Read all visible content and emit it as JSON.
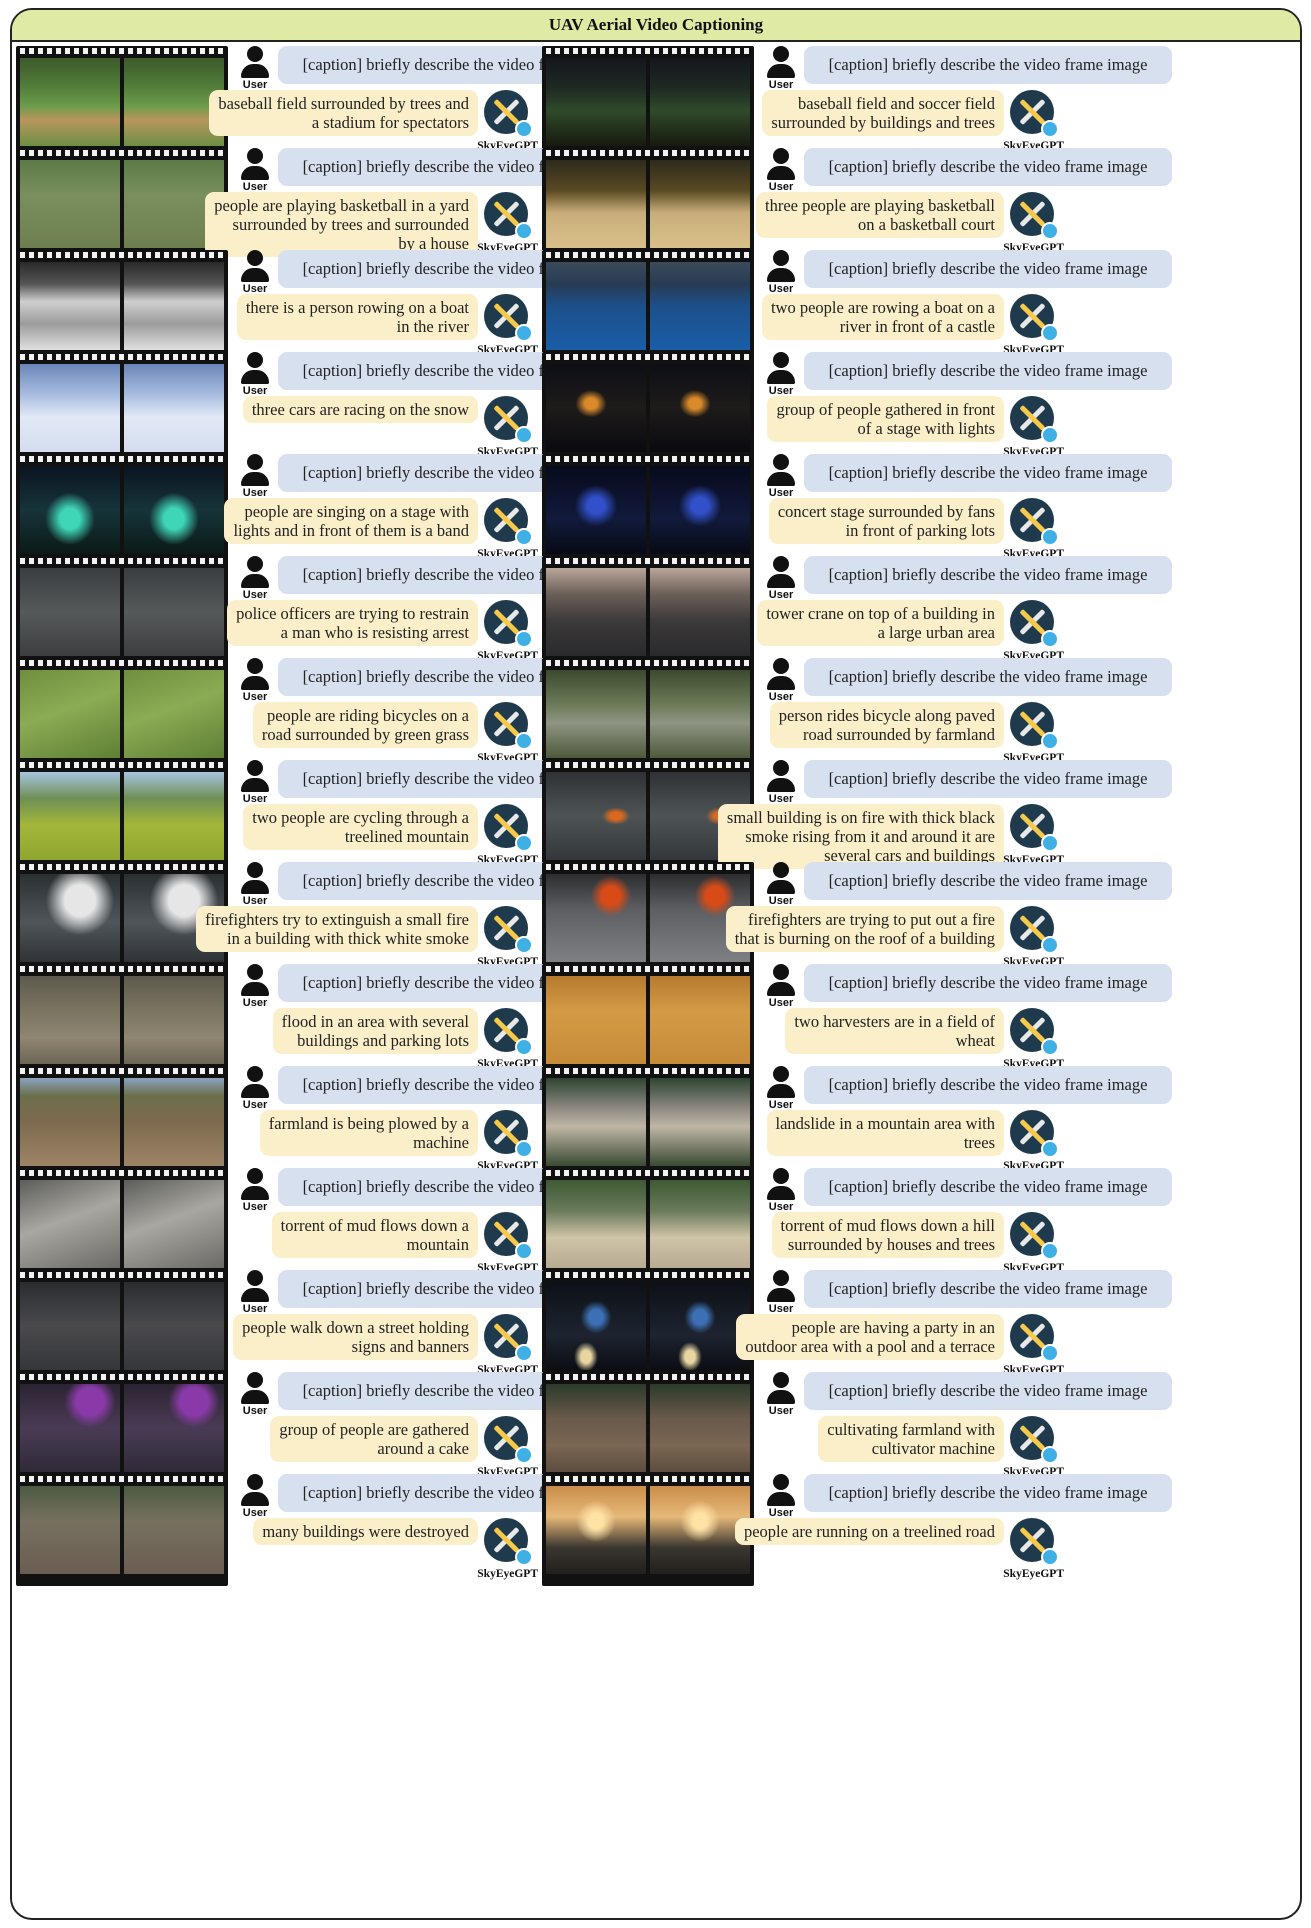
{
  "title": "UAV Aerial Video Captioning",
  "user_label": "User",
  "assistant_label": "SkyEyeGPT",
  "prompt": "[caption] briefly describe the video frame image",
  "icons": {
    "user": "user-icon",
    "assistant": "skyeyegpt-logo-icon"
  },
  "colors": {
    "banner": "#dfeaa4",
    "question_bubble": "#d7e0ef",
    "answer_bubble": "#fbefc9",
    "logo": "#1f3a4c"
  },
  "rows": [
    {
      "left": {
        "scene": "baseball-field",
        "caption": [
          "baseball field surrounded by trees and",
          "a stadium for spectators"
        ]
      },
      "right": {
        "scene": "night-ballpark",
        "caption": [
          "baseball field and soccer field",
          "surrounded by buildings and trees"
        ]
      }
    },
    {
      "left": {
        "scene": "yard-house",
        "caption": [
          "people are playing basketball in a yard",
          "surrounded by trees and surrounded",
          "by a house"
        ]
      },
      "right": {
        "scene": "basketball-court",
        "caption": [
          "three people are playing basketball",
          "on a basketball court"
        ]
      }
    },
    {
      "left": {
        "scene": "bw-river",
        "caption": [
          "there is a person rowing on a boat",
          "in the river"
        ]
      },
      "right": {
        "scene": "river-castle",
        "caption": [
          "two people are rowing a boat on a",
          "river in front of a castle"
        ]
      }
    },
    {
      "left": {
        "scene": "snow-cars",
        "caption": [
          "three cars are racing on the snow"
        ]
      },
      "right": {
        "scene": "night-stage",
        "caption": [
          "group of people gathered in front",
          "of a stage with lights"
        ]
      }
    },
    {
      "left": {
        "scene": "concert-lights",
        "caption": [
          "people are singing on a stage with",
          "lights and in front of them is a band"
        ]
      },
      "right": {
        "scene": "blue-concert",
        "caption": [
          "concert stage surrounded by fans",
          "in front of parking lots"
        ]
      }
    },
    {
      "left": {
        "scene": "police-crowd",
        "caption": [
          "police officers are trying to restrain",
          "a man who is resisting arrest"
        ]
      },
      "right": {
        "scene": "city-crane",
        "caption": [
          "tower crane on top of a building in",
          "a large urban area"
        ]
      }
    },
    {
      "left": {
        "scene": "green-grass",
        "caption": [
          "people are riding bicycles on a",
          "road surrounded by green grass"
        ]
      },
      "right": {
        "scene": "farm-road",
        "caption": [
          "person rides bicycle along paved",
          "road surrounded by farmland"
        ]
      }
    },
    {
      "left": {
        "scene": "mountain-meadow",
        "caption": [
          "two people are cycling through a",
          "treelined mountain"
        ]
      },
      "right": {
        "scene": "town-fire",
        "caption": [
          "small building is on fire with thick black",
          "smoke rising from it and around it are",
          "several cars and buildings"
        ]
      }
    },
    {
      "left": {
        "scene": "white-smoke",
        "caption": [
          "firefighters try to extinguish a small fire",
          "in a building with thick white smoke"
        ]
      },
      "right": {
        "scene": "roof-fire",
        "caption": [
          "firefighters are trying to put out a fire",
          "that is burning on the roof of a building"
        ]
      }
    },
    {
      "left": {
        "scene": "flood",
        "caption": [
          "flood in an area with several",
          "buildings and parking lots"
        ]
      },
      "right": {
        "scene": "wheat-field",
        "caption": [
          "two harvesters are in a field of",
          "wheat"
        ]
      }
    },
    {
      "left": {
        "scene": "plowed-field",
        "caption": [
          "farmland is being plowed by a",
          "machine"
        ]
      },
      "right": {
        "scene": "landslide",
        "caption": [
          "landslide in a mountain area with",
          "trees"
        ]
      }
    },
    {
      "left": {
        "scene": "mudflow",
        "caption": [
          "torrent of mud flows down a",
          "mountain"
        ]
      },
      "right": {
        "scene": "mud-houses",
        "caption": [
          "torrent of mud flows down a hill",
          "surrounded by houses and trees"
        ]
      }
    },
    {
      "left": {
        "scene": "street-crowd",
        "caption": [
          "people walk down a street holding",
          "signs and banners"
        ]
      },
      "right": {
        "scene": "night-pool",
        "caption": [
          "people are having a party in an",
          "outdoor area with a pool and a terrace"
        ]
      }
    },
    {
      "left": {
        "scene": "party-cake",
        "caption": [
          "group of people are gathered",
          "around a cake"
        ]
      },
      "right": {
        "scene": "cultivated-farm",
        "caption": [
          "cultivating farmland with",
          "cultivator machine"
        ]
      }
    },
    {
      "left": {
        "scene": "destroyed-town",
        "caption": [
          "many buildings were destroyed"
        ]
      },
      "right": {
        "scene": "sunset-road",
        "caption": [
          "people are running on a treelined road"
        ]
      }
    }
  ]
}
